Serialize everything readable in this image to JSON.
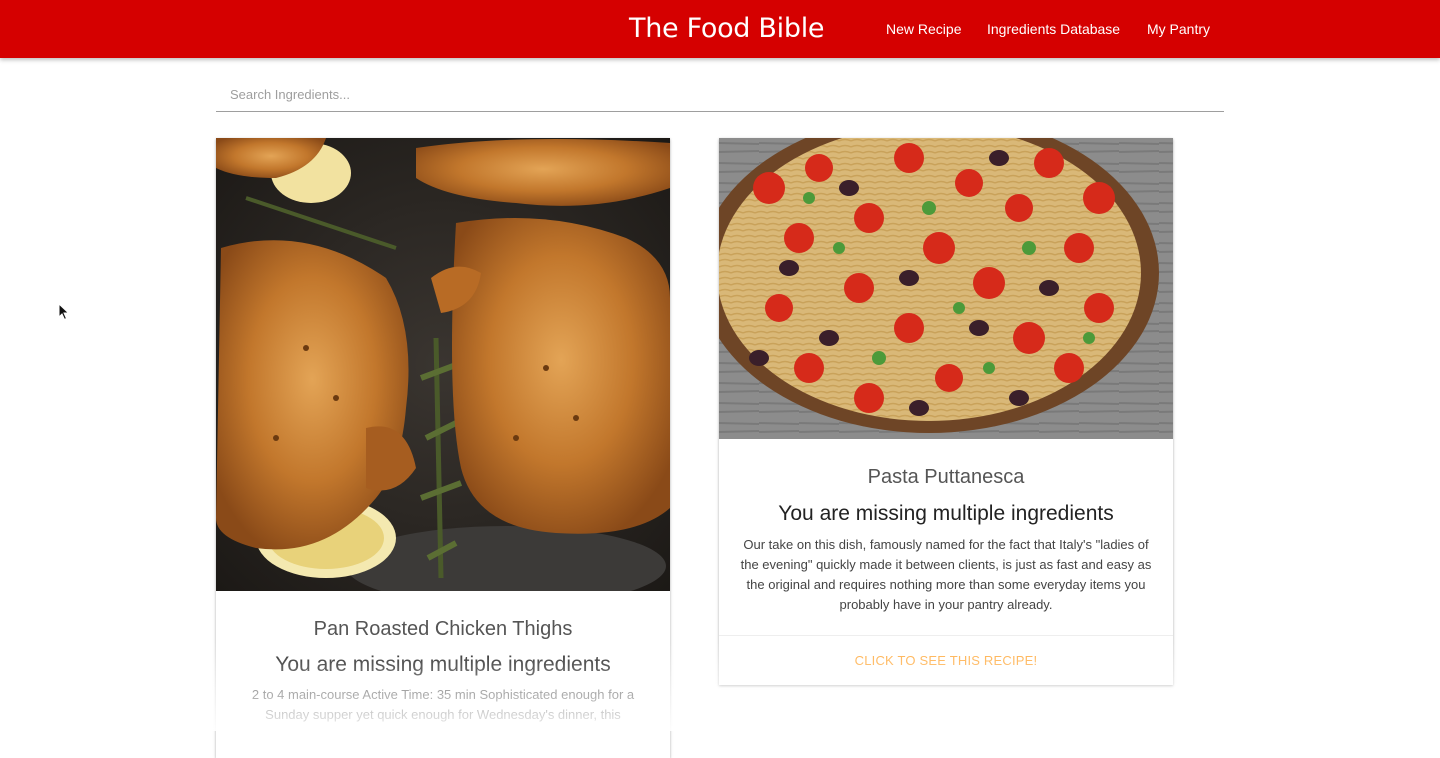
{
  "header": {
    "brand": "The Food Bible",
    "nav": [
      "New Recipe",
      "Ingredients Database",
      "My Pantry"
    ],
    "background": "#d50000"
  },
  "search": {
    "placeholder": "Search Ingredients...",
    "value": ""
  },
  "recipes": [
    {
      "title": "Pan Roasted Chicken Thighs",
      "status": "You are missing multiple ingredients",
      "description": "2 to 4 main-course Active Time: 35 min Sophisticated enough for a Sunday supper yet quick enough for Wednesday's dinner, this",
      "image": "roasted-chicken-photo"
    },
    {
      "title": "Pasta Puttanesca",
      "status": "You are missing multiple ingredients",
      "description": "Our take on this dish, famously named for the fact that Italy's \"ladies of the evening\" quickly made it between clients, is just as fast and easy as the original and requires nothing more than some everyday items you probably have in your pantry already.",
      "image": "pasta-puttanesca-photo",
      "action": "CLICK TO SEE THIS RECIPE!"
    }
  ],
  "colors": {
    "accent": "#d50000",
    "action": "#ffab40"
  }
}
